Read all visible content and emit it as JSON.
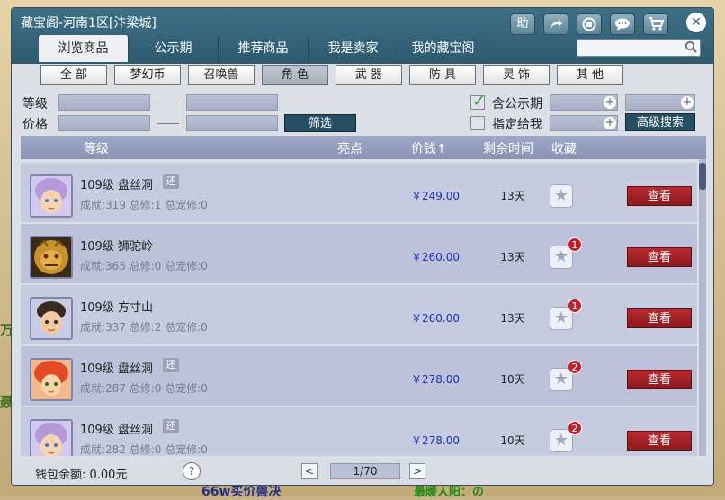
{
  "window": {
    "title": "藏宝阁-河南1区[汴梁城]"
  },
  "toolbar": {
    "help_label": "助",
    "share_icon": "share-icon",
    "record_icon": "record-icon",
    "chat_icon": "chat-icon",
    "cart_icon": "cart-icon",
    "close_label": "✕"
  },
  "tabs": [
    {
      "label": "浏览商品",
      "active": true
    },
    {
      "label": "公示期"
    },
    {
      "label": "推荐商品"
    },
    {
      "label": "我是卖家"
    },
    {
      "label": "我的藏宝阁"
    }
  ],
  "search": {
    "placeholder": ""
  },
  "categories": [
    {
      "label": "全 部"
    },
    {
      "label": "梦幻币"
    },
    {
      "label": "召唤兽"
    },
    {
      "label": "角 色",
      "active": true
    },
    {
      "label": "武 器"
    },
    {
      "label": "防 具"
    },
    {
      "label": "灵 饰"
    },
    {
      "label": "其 他"
    }
  ],
  "filters": {
    "level_label": "等级",
    "price_label": "价格",
    "filter_button": "筛选",
    "include_public_label": "含公示期",
    "include_public_checked": true,
    "assign_me_label": "指定给我",
    "assign_me_checked": false,
    "advanced_button": "高级搜索"
  },
  "table": {
    "headers": {
      "level": "等级",
      "highlight": "亮点",
      "price": "价钱↑",
      "time": "剩余时间",
      "fav": "收藏"
    },
    "rows": [
      {
        "level": "109级",
        "school": "盘丝洞",
        "tag": "还",
        "stats": "成就:319 总修:1 总宠修:0",
        "price": "￥249.00",
        "time": "13天",
        "fav_count": "",
        "view": "查看",
        "avatar": "avatar-purple-hair"
      },
      {
        "level": "109级",
        "school": "狮驼岭",
        "tag": "",
        "stats": "成就:365 总修:0 总宠修:0",
        "price": "￥260.00",
        "time": "13天",
        "fav_count": "1",
        "view": "查看",
        "avatar": "avatar-lion-mask"
      },
      {
        "level": "109级",
        "school": "方寸山",
        "tag": "",
        "stats": "成就:337 总修:2 总宠修:0",
        "price": "￥260.00",
        "time": "13天",
        "fav_count": "1",
        "view": "查看",
        "avatar": "avatar-dark-hair"
      },
      {
        "level": "109级",
        "school": "盘丝洞",
        "tag": "还",
        "stats": "成就:287 总修:0 总宠修:0",
        "price": "￥278.00",
        "time": "10天",
        "fav_count": "2",
        "view": "查看",
        "avatar": "avatar-fire-hair"
      },
      {
        "level": "109级",
        "school": "盘丝洞",
        "tag": "还",
        "stats": "成就:282 总修:0 总宠修:0",
        "price": "￥278.00",
        "time": "10天",
        "fav_count": "2",
        "view": "查看",
        "avatar": "avatar-purple-hair"
      }
    ]
  },
  "footer": {
    "wallet": "钱包余额:  0.00元",
    "help": "?",
    "prev": "<",
    "page": "1/70",
    "next": ">"
  },
  "background": {
    "text1": "万",
    "text2": "聂",
    "text3": "66w买价兽决",
    "text4": "最暖人阳：の"
  },
  "colors": {
    "accent": "#2f5a70",
    "price": "#1c2fb8",
    "view_button": "#a82228",
    "badge": "#c0202c"
  }
}
